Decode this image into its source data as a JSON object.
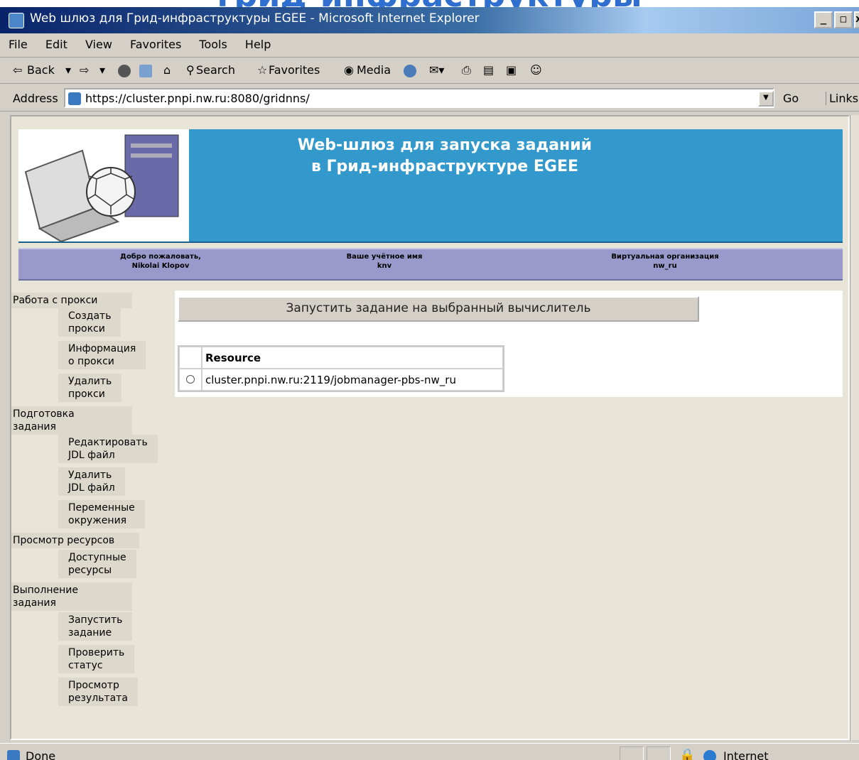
{
  "slide_heading": "грид-инфраструктуры",
  "window": {
    "title": "Web шлюз для Грид-инфраструктуры EGEE - Microsoft Internet Explorer",
    "min": "_",
    "max": "□",
    "close": "x"
  },
  "menu": [
    "File",
    "Edit",
    "View",
    "Favorites",
    "Tools",
    "Help"
  ],
  "toolbar": {
    "back": "Back",
    "search": "Search",
    "favorites": "Favorites",
    "media": "Media"
  },
  "address": {
    "label": "Address",
    "url": "https://cluster.pnpi.nw.ru:8080/gridnns/",
    "go": "Go",
    "links": "Links"
  },
  "banner": {
    "line1": "Web-шлюз для запуска заданий",
    "line2": "в Грид-инфраструктуре EGEE"
  },
  "userbar": {
    "welcome_label": "Добро пожаловать,",
    "welcome_name": "Nikolai Klopov",
    "account_label": "Ваше учётное имя",
    "account_value": "knv",
    "vo_label": "Виртуальная организация",
    "vo_value": "nw_ru"
  },
  "nav": {
    "g1": "Работа с прокси",
    "g1_items": [
      "Создать\nпрокси",
      "Информация\nо прокси",
      "Удалить\nпрокси"
    ],
    "g2": "Подготовка\nзадания",
    "g2_items": [
      "Редактировать\nJDL файл",
      "Удалить\nJDL файл",
      "Переменные\nокружения"
    ],
    "g3": "Просмотр ресурсов",
    "g3_items": [
      "Доступные\nресурсы"
    ],
    "g4": "Выполнение\nзадания",
    "g4_items": [
      "Запустить\nзадание",
      "Проверить\nстатус",
      "Просмотр\nрезультата"
    ]
  },
  "main": {
    "run_button": "Запустить задание на выбранный вычислитель",
    "table_header": "Resource",
    "rows": [
      "cluster.pnpi.nw.ru:2119/jobmanager-pbs-nw_ru"
    ]
  },
  "status": {
    "text": "Done",
    "zone": "Internet"
  }
}
